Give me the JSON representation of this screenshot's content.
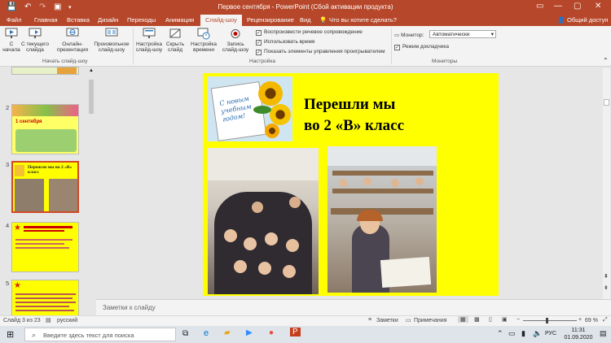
{
  "window": {
    "title": "Первое сентября - PowerPoint (Сбой активации продукта)",
    "minimize": "—",
    "maximize": "▢",
    "close": "✕"
  },
  "tabs": [
    "Файл",
    "Главная",
    "Вставка",
    "Дизайн",
    "Переходы",
    "Анимация",
    "Слайд-шоу",
    "Рецензирование",
    "Вид"
  ],
  "active_tab": "Слайд-шоу",
  "tell_me": "Что вы хотите сделать?",
  "share": "Общий доступ",
  "ribbon": {
    "btn_from_start": "С начала",
    "btn_from_current": "С текущего слайда",
    "btn_online": "Онлайн-презентация",
    "btn_custom": "Произвольное слайд-шоу",
    "group_start": "Начать слайд-шоу",
    "btn_setup": "Настройка слайд-шоу",
    "btn_hide": "Скрыть слайд",
    "btn_timings": "Настройка времени",
    "btn_record": "Запись слайд-шоу",
    "chk_narration": "Воспроизвести речевое сопровождение",
    "chk_timings": "Использовать время",
    "chk_controls": "Показать элементы управления проигрывателем",
    "group_setup": "Настройка",
    "monitor_label": "Монитор:",
    "monitor_value": "Автоматически",
    "chk_presenter": "Режим докладчика",
    "group_monitors": "Мониторы"
  },
  "thumbnails": [
    {
      "num": "2"
    },
    {
      "num": "3"
    },
    {
      "num": "4"
    },
    {
      "num": "5"
    }
  ],
  "thumb3_title": "Перешли мы во 2 «В» класс",
  "thumb2_label": "1 сентября",
  "slide": {
    "heading_line1": "Перешли мы",
    "heading_line2": "во 2 «В» класс",
    "card_text": "С новым учебным годом!"
  },
  "notes_placeholder": "Заметки к слайду",
  "status": {
    "slide_counter": "Слайд 3 из 23",
    "language": "русский",
    "notes_btn": "Заметки",
    "comments_btn": "Примечания",
    "zoom": "69 %"
  },
  "taskbar": {
    "search_placeholder": "Введите здесь текст для поиска",
    "lang": "РУС",
    "time": "11:31",
    "date": "01.09.2020"
  },
  "colors": {
    "accent": "#b7472a",
    "slide_bg": "#ffff00",
    "selected_thumb_border": "#d24726"
  }
}
